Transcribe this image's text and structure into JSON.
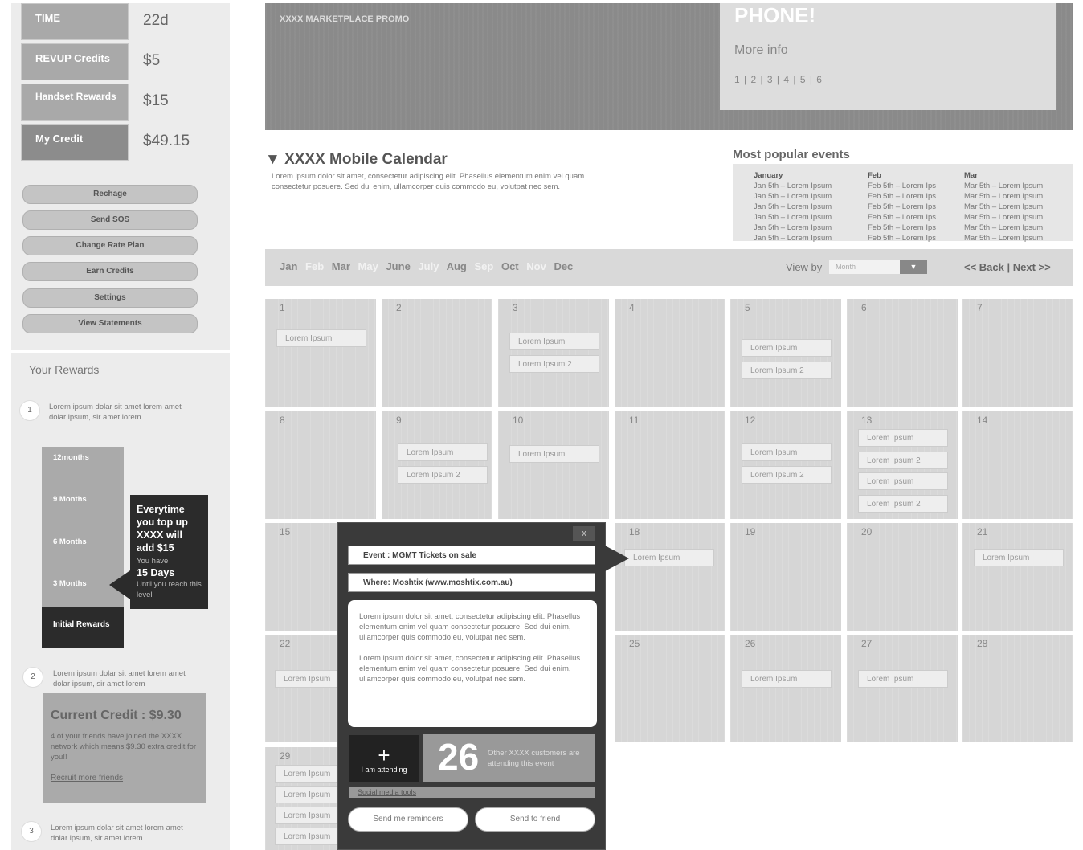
{
  "account": {
    "time_label": "TIME",
    "time_value": "22d",
    "revup_label": "REVUP Credits",
    "revup_value": "$5",
    "handset_label": "Handset Rewards",
    "handset_value": "$15",
    "credit_label": "My Credit",
    "credit_value": "$49.15"
  },
  "actions": [
    "Rechage",
    "Send SOS",
    "Change Rate Plan",
    "Earn Credits",
    "Settings",
    "View Statements"
  ],
  "rewards": {
    "title": "Your Rewards",
    "step1": "1",
    "step1_text": "Lorem ipsum dolar sit amet lorem amet dolar ipsum, sir amet lorem",
    "levels": [
      "12months",
      "9 Months",
      "6 Months",
      "3 Months"
    ],
    "initial": "Initial Rewards",
    "callout_line1": "Everytime you top up XXXX will add $15",
    "callout_have": "You have",
    "callout_days": "15 Days",
    "callout_until": "Until you reach this level",
    "step2": "2",
    "step2_text": "Lorem ipsum dolar sit amet lorem amet dolar ipsum, sir amet lorem",
    "current_credit": "Current Credit : $9.30",
    "credit_desc": "4 of your friends  have joined the XXXX network which means $9.30 extra credit for you!!",
    "recruit": "Recruit more friends",
    "step3": "3",
    "step3_text": "Lorem ipsum dolar sit amet lorem amet dolar ipsum, sir amet lorem"
  },
  "banner": {
    "title": "XXXX MARKETPLACE PROMO",
    "phone": "PHONE!",
    "more": "More info",
    "pages": "1 | 2 | 3 | 4 | 5 | 6"
  },
  "calendar": {
    "title": "▼ XXXX Mobile Calendar",
    "desc": "Lorem ipsum dolor sit amet, consectetur adipiscing elit. Phasellus elementum enim vel quam consectetur posuere. Sed dui enim, ullamcorper quis commodo eu, volutpat nec sem.",
    "popular_title": "Most popular events",
    "popular": {
      "jan_head": "January",
      "jan": "Jan 5th – Lorem Ipsum",
      "feb_head": "Feb",
      "feb": "Feb 5th – Lorem Ips",
      "mar_head": "Mar",
      "mar": "Mar 5th – Lorem Ipsum"
    },
    "months": [
      "Jan",
      "Feb",
      "Mar",
      "May",
      "June",
      "July",
      "Aug",
      "Sep",
      "Oct",
      "Nov",
      "Dec"
    ],
    "view_by": "View by",
    "view_select": "Month",
    "view_arrow": "▼",
    "back_next": "<< Back | Next >>",
    "event": "Lorem Ipsum",
    "event2": "Lorem Ipsum 2"
  },
  "popup": {
    "close": "x",
    "event": "Event : MGMT Tickets on sale",
    "where": "Where: Moshtix (www.moshtix.com.au)",
    "body1": "Lorem ipsum dolor sit amet, consectetur adipiscing elit. Phasellus elementum enim vel quam consectetur posuere. Sed dui enim, ullamcorper quis commodo eu, volutpat nec sem.",
    "body2": "Lorem ipsum dolor sit amet, consectetur adipiscing elit. Phasellus elementum enim vel quam consectetur posuere. Sed dui enim, ullamcorper quis commodo eu, volutpat nec sem.",
    "plus": "+",
    "attending": "I am attending",
    "count": "26",
    "others": "Other XXXX customers are attending this event",
    "social": "Social media tools",
    "remind": "Send me reminders",
    "send": "Send to friend"
  }
}
